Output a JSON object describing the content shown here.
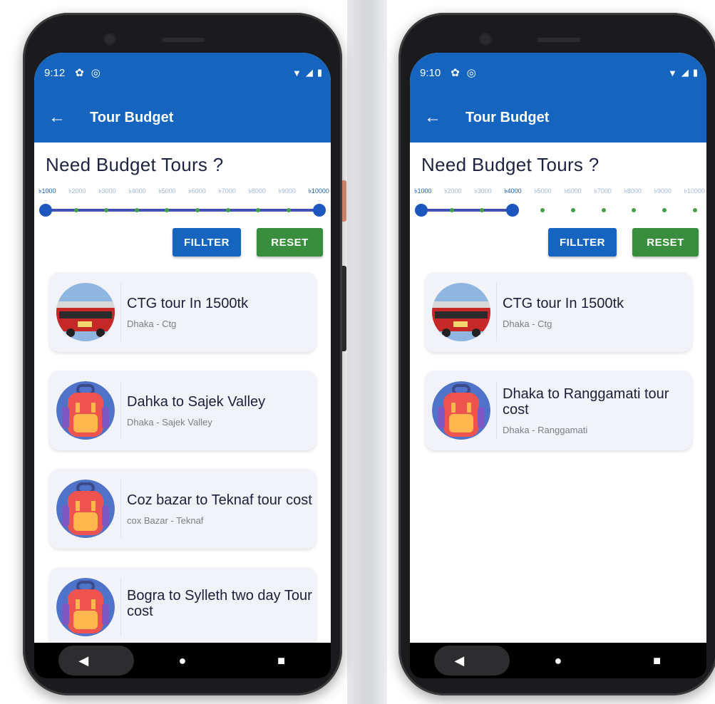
{
  "screens": [
    {
      "status": {
        "time": "9:12"
      },
      "appbar": {
        "title": "Tour Budget"
      },
      "heading": "Need Budget Tours ?",
      "slider": {
        "ticks": [
          "৳1000",
          "৳2000",
          "৳3000",
          "৳4000",
          "৳5000",
          "৳6000",
          "৳7000",
          "৳8000",
          "৳9000",
          "৳10000"
        ],
        "range_start": "৳1000",
        "range_end": "৳10000"
      },
      "buttons": {
        "filter": "FILLTER",
        "reset": "RESET"
      },
      "cards": [
        {
          "title": "CTG tour In 1500tk",
          "subtitle": "Dhaka - Ctg",
          "image": "bus-image"
        },
        {
          "title": "Dahka to Sajek Valley",
          "subtitle": "Dhaka - Sajek Valley",
          "image": "backpack-icon"
        },
        {
          "title": "Coz bazar to Teknaf tour cost",
          "subtitle": "cox Bazar - Teknaf",
          "image": "backpack-icon"
        },
        {
          "title": "Bogra to Sylleth two day Tour cost",
          "subtitle": "",
          "image": "backpack-icon"
        }
      ]
    },
    {
      "status": {
        "time": "9:10"
      },
      "appbar": {
        "title": "Tour Budget"
      },
      "heading": "Need Budget Tours ?",
      "slider": {
        "ticks": [
          "৳1000",
          "৳2000",
          "৳3000",
          "৳4000",
          "৳5000",
          "৳6000",
          "৳7000",
          "৳8000",
          "৳9000",
          "৳10000"
        ],
        "range_start": "৳1000",
        "range_end": "৳4000"
      },
      "buttons": {
        "filter": "FILLTER",
        "reset": "RESET"
      },
      "cards": [
        {
          "title": "CTG tour In 1500tk",
          "subtitle": "Dhaka - Ctg",
          "image": "bus-image"
        },
        {
          "title": "Dhaka to Ranggamati tour cost",
          "subtitle": "Dhaka - Ranggamati",
          "image": "backpack-icon"
        }
      ]
    }
  ],
  "colors": {
    "primary": "#1565c0",
    "accent_green": "#388e3c",
    "slider_track": "#3f51b5"
  },
  "icons": [
    "back-arrow-icon",
    "settings-icon",
    "sync-icon",
    "wifi-icon",
    "signal-icon",
    "battery-icon",
    "nav-back-icon",
    "nav-home-icon",
    "nav-recents-icon"
  ]
}
